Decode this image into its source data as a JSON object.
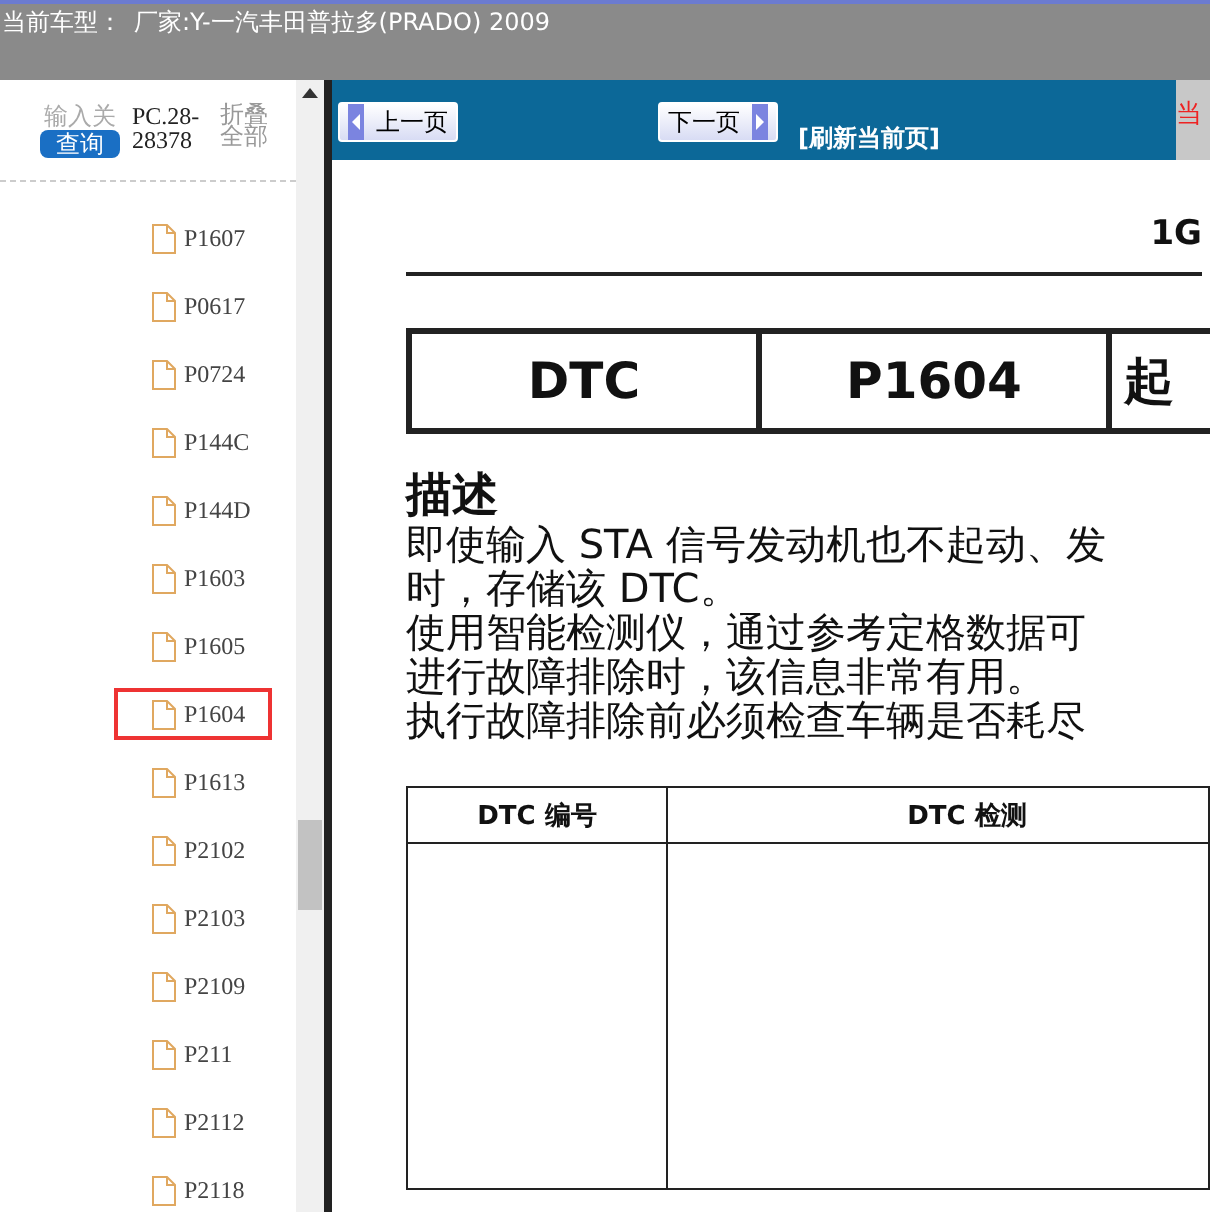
{
  "title_bar": {
    "label": "当前车型：",
    "value": "厂家:Y-一汽丰田普拉多(PRADO) 2009"
  },
  "sidebar": {
    "input_label": "输入关",
    "query_button": "查询",
    "code": "PC.28-28378",
    "collapse": "折叠全部",
    "items": [
      {
        "label": "P1607",
        "selected": false
      },
      {
        "label": "P0617",
        "selected": false
      },
      {
        "label": "P0724",
        "selected": false
      },
      {
        "label": "P144C",
        "selected": false
      },
      {
        "label": "P144D",
        "selected": false
      },
      {
        "label": "P1603",
        "selected": false
      },
      {
        "label": "P1605",
        "selected": false
      },
      {
        "label": "P1604",
        "selected": true
      },
      {
        "label": "P1613",
        "selected": false
      },
      {
        "label": "P2102",
        "selected": false
      },
      {
        "label": "P2103",
        "selected": false
      },
      {
        "label": "P2109",
        "selected": false
      },
      {
        "label": "P211",
        "selected": false
      },
      {
        "label": "P2112",
        "selected": false
      },
      {
        "label": "P2118",
        "selected": false
      }
    ]
  },
  "nav": {
    "prev": "上一页",
    "next": "下一页",
    "refresh": "[刷新当前页]",
    "side_text": "当"
  },
  "document": {
    "header": "1G",
    "dtc_table": [
      "DTC",
      "P1604",
      "起"
    ],
    "heading": "描述",
    "lines": [
      "即使输入 STA 信号发动机也不起动、发",
      "时，存储该 DTC。",
      "使用智能检测仪，通过参考定格数据可",
      "进行故障排除时，该信息非常有用。",
      "执行故障排除前必须检查车辆是否耗尽"
    ],
    "table_columns": [
      "DTC 编号",
      "DTC 检测"
    ]
  }
}
